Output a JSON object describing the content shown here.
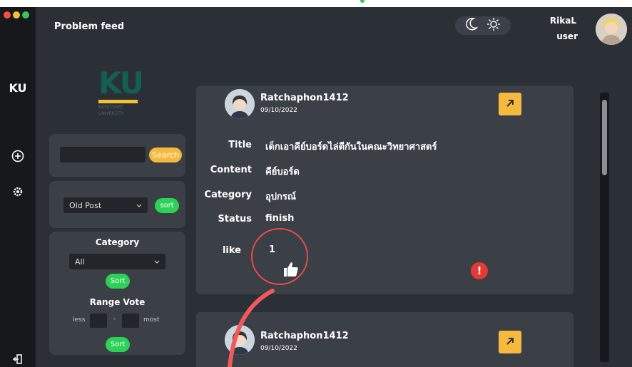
{
  "window": {
    "controls": [
      "close",
      "minimize",
      "maximize"
    ]
  },
  "rail": {
    "brand": "KU",
    "icons": [
      "add-circle-icon",
      "settings-icon",
      "logout-icon"
    ]
  },
  "header": {
    "title": "Problem feed",
    "theme_icons": [
      "moon-icon",
      "sun-icon"
    ],
    "user_name": "RikaL",
    "user_role": "user"
  },
  "logo": {
    "text": "KU",
    "subtext_1": "KASETSART",
    "subtext_2": "UNIVERSITY"
  },
  "search": {
    "value": "",
    "button_label": "Search"
  },
  "sort": {
    "selected": "Old Post",
    "button_label": "sort"
  },
  "category_filter": {
    "title": "Category",
    "selected": "All",
    "button_label": "Sort"
  },
  "range_vote": {
    "title": "Range Vote",
    "less_label": "less",
    "separator": "-",
    "most_label": "most",
    "less_value": "",
    "most_value": "",
    "button_label": "Sort"
  },
  "posts": [
    {
      "username": "Ratchaphon1412",
      "date": "09/10/2022",
      "fields": [
        {
          "label": "Title",
          "value": "เด็กเอาคีย์บอร์ดไล่ตีกันในคณะวิทยาศาสตร์"
        },
        {
          "label": "Content",
          "value": "คีย์บอร์ด"
        },
        {
          "label": "Category",
          "value": "อุปกรณ์"
        },
        {
          "label": "Status",
          "value": "finish"
        },
        {
          "label": "like",
          "value": "1"
        }
      ]
    },
    {
      "username": "Ratchaphon1412",
      "date": "09/10/2022"
    }
  ],
  "colors": {
    "background": "#2b2f36",
    "panel": "#3b3f46",
    "rail": "#16181c",
    "accent_yellow": "#f5b93d",
    "accent_green": "#2ed158",
    "alert_red": "#e53935",
    "annotation_red": "#f05a5a"
  }
}
